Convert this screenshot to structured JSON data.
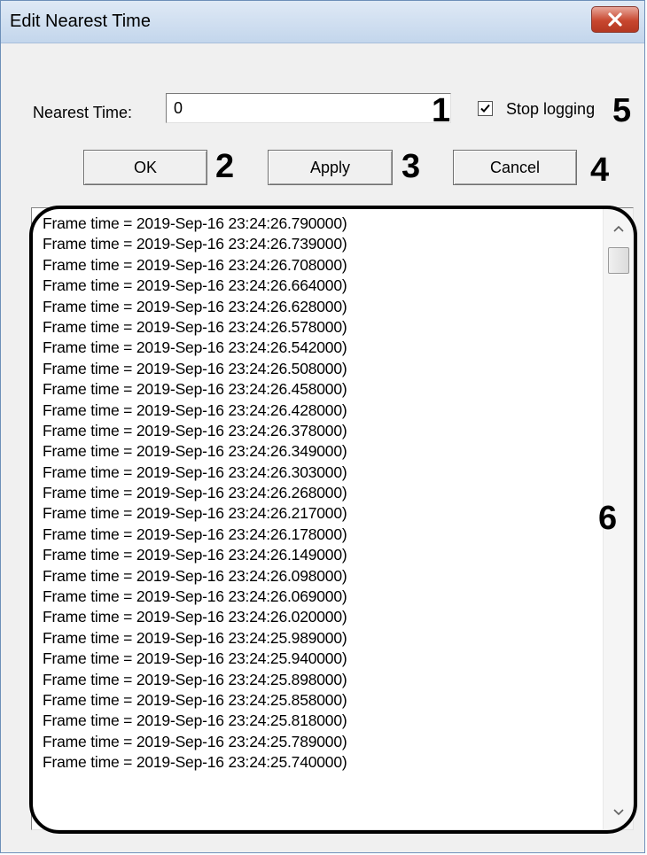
{
  "window": {
    "title": "Edit Nearest Time",
    "close_icon": "close-icon"
  },
  "nearest_time": {
    "label": "Nearest Time:",
    "value": "0"
  },
  "stop_logging": {
    "label": "Stop logging",
    "checked": true
  },
  "buttons": {
    "ok": "OK",
    "apply": "Apply",
    "cancel": "Cancel"
  },
  "callouts": {
    "n1": "1",
    "n2": "2",
    "n3": "3",
    "n4": "4",
    "n5": "5",
    "n6": "6"
  },
  "log": {
    "lines": [
      "Frame time = 2019-Sep-16 23:24:26.790000)",
      "Frame time = 2019-Sep-16 23:24:26.739000)",
      "Frame time = 2019-Sep-16 23:24:26.708000)",
      "Frame time = 2019-Sep-16 23:24:26.664000)",
      "Frame time = 2019-Sep-16 23:24:26.628000)",
      "Frame time = 2019-Sep-16 23:24:26.578000)",
      "Frame time = 2019-Sep-16 23:24:26.542000)",
      "Frame time = 2019-Sep-16 23:24:26.508000)",
      "Frame time = 2019-Sep-16 23:24:26.458000)",
      "Frame time = 2019-Sep-16 23:24:26.428000)",
      "Frame time = 2019-Sep-16 23:24:26.378000)",
      "Frame time = 2019-Sep-16 23:24:26.349000)",
      "Frame time = 2019-Sep-16 23:24:26.303000)",
      "Frame time = 2019-Sep-16 23:24:26.268000)",
      "Frame time = 2019-Sep-16 23:24:26.217000)",
      "Frame time = 2019-Sep-16 23:24:26.178000)",
      "Frame time = 2019-Sep-16 23:24:26.149000)",
      "Frame time = 2019-Sep-16 23:24:26.098000)",
      "Frame time = 2019-Sep-16 23:24:26.069000)",
      "Frame time = 2019-Sep-16 23:24:26.020000)",
      "Frame time = 2019-Sep-16 23:24:25.989000)",
      "Frame time = 2019-Sep-16 23:24:25.940000)",
      "Frame time = 2019-Sep-16 23:24:25.898000)",
      "Frame time = 2019-Sep-16 23:24:25.858000)",
      "Frame time = 2019-Sep-16 23:24:25.818000)",
      "Frame time = 2019-Sep-16 23:24:25.789000)",
      "Frame time = 2019-Sep-16 23:24:25.740000)"
    ]
  },
  "colors": {
    "close_button": "#c8472f",
    "titlebar": "#c3d6ec",
    "dialog_background": "#f0f0f0"
  }
}
